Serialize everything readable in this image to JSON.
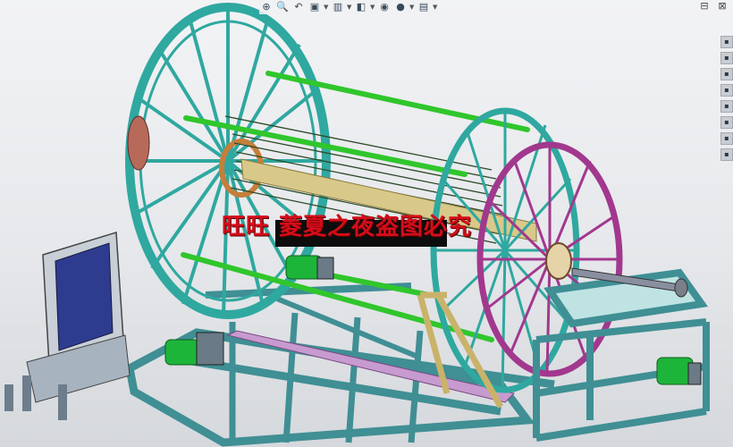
{
  "toolbar": {
    "items": [
      {
        "name": "zoom-to-fit-icon",
        "glyph": "⊕"
      },
      {
        "name": "zoom-to-area-icon",
        "glyph": "🔍"
      },
      {
        "name": "previous-view-icon",
        "glyph": "↶"
      },
      {
        "name": "section-view-icon",
        "glyph": "▣"
      },
      {
        "name": "view-orientation-icon",
        "glyph": "▥"
      },
      {
        "name": "display-style-icon",
        "glyph": "◧"
      },
      {
        "name": "hide-show-items-icon",
        "glyph": "◉"
      },
      {
        "name": "edit-appearance-icon",
        "glyph": "●"
      },
      {
        "name": "apply-scene-icon",
        "glyph": "▤"
      }
    ]
  },
  "window_controls": {
    "restore": "⊟",
    "close": "⊠"
  },
  "task_pane": {
    "tabs": [
      "▪",
      "▪",
      "▪",
      "▪",
      "▪",
      "▪",
      "▪",
      "▪"
    ]
  },
  "watermark": {
    "text": "旺旺 菱夏之夜盗图必究"
  },
  "colors": {
    "cyan_wheel": "#2fa8a0",
    "magenta_wheel": "#a2388e",
    "green_rod": "#30c62c",
    "frame_teal": "#3f8f94",
    "pink_beam": "#c79ad0",
    "motor_green": "#1db43a",
    "cabinet_blue": "#2d3c8e",
    "watermark_red": "#d40d1a"
  }
}
